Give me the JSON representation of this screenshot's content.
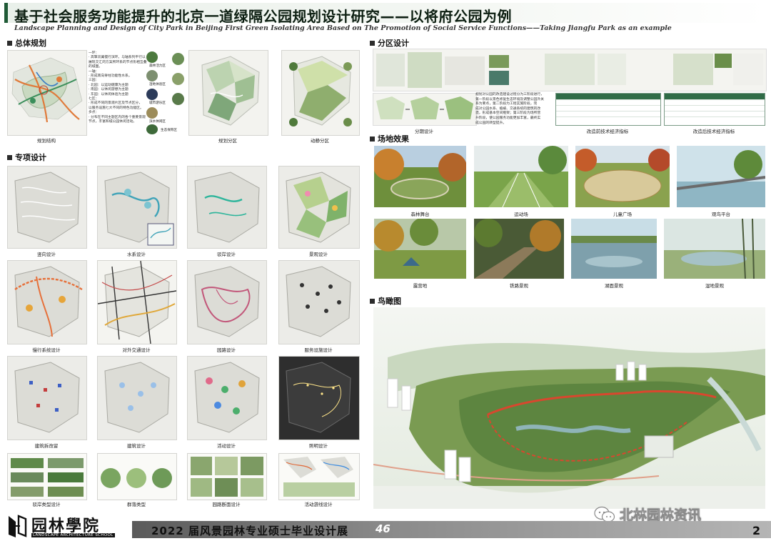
{
  "header": {
    "title_cn": "基于社会服务功能提升的北京一道绿隔公园规划设计研究——以将府公园为例",
    "title_en": "Landscape Planning and Design of City Park in Beijing First Green Isolating Area Based on The Promotion of Social Service Functions——Taking Jiangfu Park as an example"
  },
  "sections": {
    "master_plan": "总体规划",
    "special_design": "专项设计",
    "zoning": "分区设计",
    "site_effect": "场地效果",
    "aerial": "鸟瞰图"
  },
  "master_plan": {
    "captions": [
      "规划结构",
      "规划分区",
      "动静分区"
    ],
    "notes": [
      "一环：",
      "· 高擎双翼慢行滨环。与轴系列平行以",
      "  展现交汇的方案所环系的节点形相互叠",
      "  的城面。",
      "一轴：",
      "· 形成南向脊柱功能性水系。",
      "三园：",
      "· 北园：以运动健康为主题",
      "· 南园：以休闲游憩为主题",
      "· 东园：以休闲体验为主题",
      "七区：",
      "· 形成不同的景观片区及节点区分，",
      "  以服务设施七大不同的特色功能区。",
      "多点：",
      "· 分布在不同主题区内的各个重要景观",
      "  节点，丰富和城公园休闲活动。"
    ],
    "legend": [
      "森林活力区",
      "湿地体验区",
      "城市游乐区",
      "滨水休闲区",
      "生态保育区"
    ]
  },
  "special_design": {
    "captions": [
      "竖向设计",
      "水系设计",
      "驳岸设计",
      "景观设计",
      "慢行系统设计",
      "对外交通设计",
      "园路设计",
      "服务设施设计",
      "建筑拆改留",
      "建筑设计",
      "活动设计",
      "照明设计",
      "驳岸类型设计",
      "群落类型",
      "园路断面设计",
      "活动游线设计"
    ]
  },
  "zoning": {
    "text": [
      "规划对公园的改造建设过程分为三阶段进行，",
      "第一阶段以景色修复生态环境及调整公园外关",
      "系为要点，第二阶段为工程实施阶段，完",
      "成对公园水系、植被、交通系统的建筑的改",
      "造，形成基本空间框架；第三阶段为场所营",
      "升阶段，使公园服务功能更加丰富，最终实",
      "成公园的转型提升。"
    ],
    "captions": [
      "分期设计",
      "改造前技术经济指标",
      "改造后技术经济指标"
    ]
  },
  "site_effect": {
    "captions": [
      "森林舞台",
      "运动场",
      "儿童广场",
      "观鸟平台",
      "露营地",
      "铁路景观",
      "湖面景观",
      "湿地景观"
    ]
  },
  "footer": {
    "logo_cn": "园林學院",
    "logo_en": "LANDSCAPE ARCHITECTURE SCHOOL",
    "exhibition": "2022 届风景园林专业硕士毕业设计展",
    "number": "46",
    "page": "2",
    "watermark": "北林园林资讯"
  },
  "colors": {
    "accent_green": "#1f5a36",
    "table_header": "#2f6b47",
    "footer_gray": "#8a8a8a"
  }
}
